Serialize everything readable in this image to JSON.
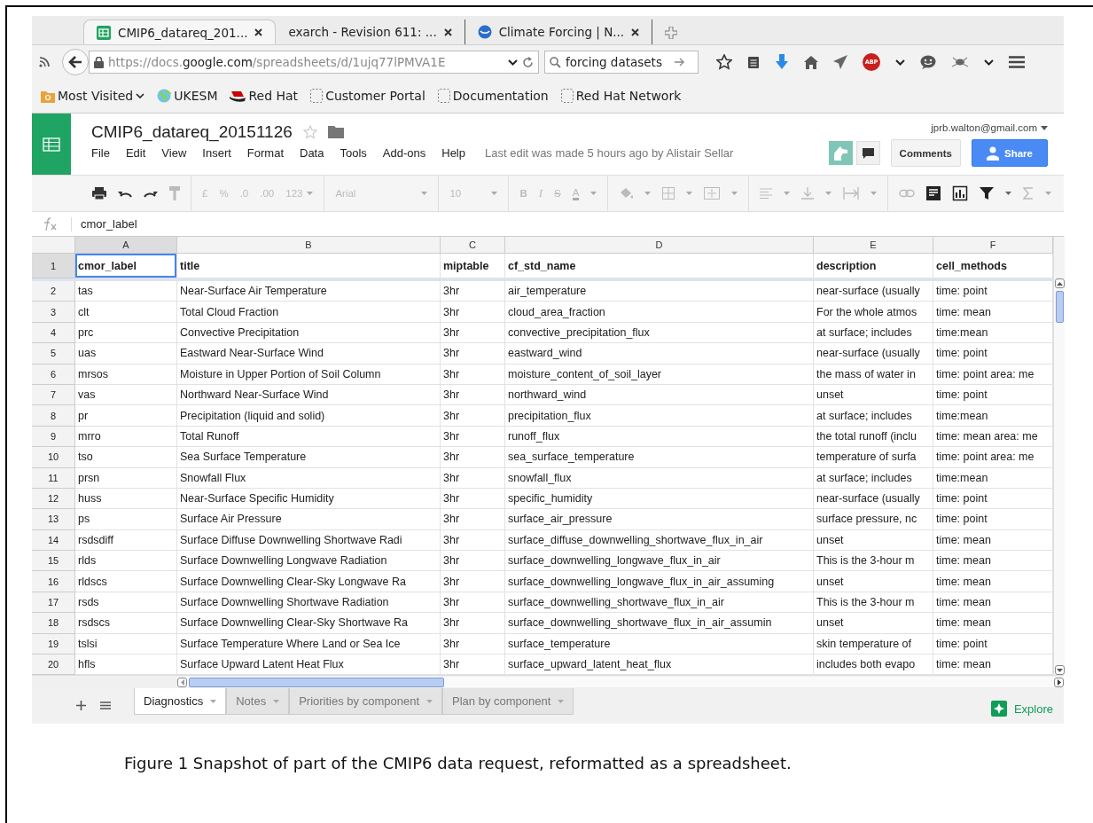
{
  "browser": {
    "tabs": [
      {
        "label": "CMIP6_datareq_201...",
        "selected": true,
        "kind": "sheets"
      },
      {
        "label": "exarch - Revision 611: ...",
        "selected": false,
        "kind": "plain"
      },
      {
        "label": "Climate Forcing | N...",
        "selected": false,
        "kind": "globe"
      }
    ],
    "url": "https://docs.**google.com**/spreadsheets/d/1ujq77lPMVA1E",
    "search": {
      "value": "forcing datasets"
    },
    "extension_badge": "ABP",
    "bookmarks": [
      {
        "label": "Most Visited",
        "kind": "folder"
      },
      {
        "label": "UKESM",
        "kind": "globe"
      },
      {
        "label": "Red Hat",
        "kind": "redhat"
      },
      {
        "label": "Customer Portal",
        "kind": "blank"
      },
      {
        "label": "Documentation",
        "kind": "blank"
      },
      {
        "label": "Red Hat Network",
        "kind": "blank"
      }
    ]
  },
  "sheets": {
    "title": "CMIP6_datareq_20151126",
    "menus": [
      "File",
      "Edit",
      "View",
      "Insert",
      "Format",
      "Data",
      "Tools",
      "Add-ons",
      "Help"
    ],
    "last_edit": "Last edit was made 5 hours ago by Alistair Sellar",
    "account": "jprb.walton@gmail.com",
    "comments_button": "Comments",
    "share_button": "Share",
    "toolbar": {
      "currency": "£",
      "percent": "%",
      "decimal_less": ".0",
      "decimal_more": ".00",
      "number_format": "123",
      "font": "Arial",
      "font_size": "10",
      "bold": "B",
      "italic": "I",
      "strikethrough": "S",
      "text_color": "A"
    },
    "formula": "cmor_label",
    "columns": [
      {
        "letter": "A",
        "selected": true
      },
      {
        "letter": "B",
        "selected": false
      },
      {
        "letter": "C",
        "selected": false
      },
      {
        "letter": "D",
        "selected": false
      },
      {
        "letter": "E",
        "selected": false
      },
      {
        "letter": "F",
        "selected": false
      }
    ],
    "header_row": {
      "number": "1",
      "selected": true,
      "cells": [
        "cmor_label",
        "title",
        "miptable",
        "cf_std_name",
        "description",
        "cell_methods"
      ]
    },
    "rows": [
      {
        "number": "2",
        "cells": [
          "tas",
          "Near-Surface Air Temperature",
          "3hr",
          "air_temperature",
          "near-surface (usually",
          "time: point"
        ]
      },
      {
        "number": "3",
        "cells": [
          "clt",
          "Total Cloud Fraction",
          "3hr",
          "cloud_area_fraction",
          "For the whole atmos",
          "time: mean"
        ]
      },
      {
        "number": "4",
        "cells": [
          "prc",
          "Convective Precipitation",
          "3hr",
          "convective_precipitation_flux",
          "at surface; includes",
          "time:mean"
        ]
      },
      {
        "number": "5",
        "cells": [
          "uas",
          "Eastward Near-Surface Wind",
          "3hr",
          "eastward_wind",
          "near-surface (usually",
          "time: point"
        ]
      },
      {
        "number": "6",
        "cells": [
          "mrsos",
          "Moisture in Upper Portion of Soil Column",
          "3hr",
          "moisture_content_of_soil_layer",
          "the mass of water in",
          "time: point area: me"
        ]
      },
      {
        "number": "7",
        "cells": [
          "vas",
          "Northward Near-Surface Wind",
          "3hr",
          "northward_wind",
          "unset",
          "time: point"
        ]
      },
      {
        "number": "8",
        "cells": [
          "pr",
          "Precipitation (liquid and solid)",
          "3hr",
          "precipitation_flux",
          "at surface; includes",
          "time:mean"
        ]
      },
      {
        "number": "9",
        "cells": [
          "mrro",
          "Total Runoff",
          "3hr",
          "runoff_flux",
          "the total runoff (inclu",
          "time: mean area: me"
        ]
      },
      {
        "number": "10",
        "cells": [
          "tso",
          "Sea Surface Temperature",
          "3hr",
          "sea_surface_temperature",
          "temperature of surfa",
          "time: point area: me"
        ]
      },
      {
        "number": "11",
        "cells": [
          "prsn",
          "Snowfall Flux",
          "3hr",
          "snowfall_flux",
          "at surface; includes",
          "time:mean"
        ]
      },
      {
        "number": "12",
        "cells": [
          "huss",
          "Near-Surface Specific Humidity",
          "3hr",
          "specific_humidity",
          "near-surface (usually",
          "time: point"
        ]
      },
      {
        "number": "13",
        "cells": [
          "ps",
          "Surface Air Pressure",
          "3hr",
          "surface_air_pressure",
          "surface pressure, nc",
          "time: point"
        ]
      },
      {
        "number": "14",
        "cells": [
          "rsdsdiff",
          "Surface Diffuse Downwelling Shortwave Radi",
          "3hr",
          "surface_diffuse_downwelling_shortwave_flux_in_air",
          "unset",
          "time: mean"
        ]
      },
      {
        "number": "15",
        "cells": [
          "rlds",
          "Surface Downwelling Longwave Radiation",
          "3hr",
          "surface_downwelling_longwave_flux_in_air",
          "This is the 3-hour m",
          "time: mean"
        ]
      },
      {
        "number": "16",
        "cells": [
          "rldscs",
          "Surface Downwelling Clear-Sky Longwave Ra",
          "3hr",
          "surface_downwelling_longwave_flux_in_air_assuming",
          "unset",
          "time: mean"
        ]
      },
      {
        "number": "17",
        "cells": [
          "rsds",
          "Surface Downwelling Shortwave Radiation",
          "3hr",
          "surface_downwelling_shortwave_flux_in_air",
          "This is the 3-hour m",
          "time: mean"
        ]
      },
      {
        "number": "18",
        "cells": [
          "rsdscs",
          "Surface Downwelling Clear-Sky Shortwave Ra",
          "3hr",
          "surface_downwelling_shortwave_flux_in_air_assumin",
          "unset",
          "time: mean"
        ]
      },
      {
        "number": "19",
        "cells": [
          "tslsi",
          "Surface Temperature Where Land or Sea Ice",
          "3hr",
          "surface_temperature",
          "skin temperature of",
          "time: point"
        ]
      },
      {
        "number": "20",
        "cells": [
          "hfls",
          "Surface Upward Latent Heat Flux",
          "3hr",
          "surface_upward_latent_heat_flux",
          "includes both evapo",
          "time: mean"
        ]
      }
    ],
    "sheet_tabs": [
      {
        "label": "Diagnostics",
        "selected": true
      },
      {
        "label": "Notes",
        "selected": false
      },
      {
        "label": "Priorities by component",
        "selected": false
      },
      {
        "label": "Plan by component",
        "selected": false
      }
    ],
    "explore_button": "Explore"
  },
  "caption": "Figure 1 Snapshot of part of the CMIP6 data request, reformatted as a spreadsheet."
}
